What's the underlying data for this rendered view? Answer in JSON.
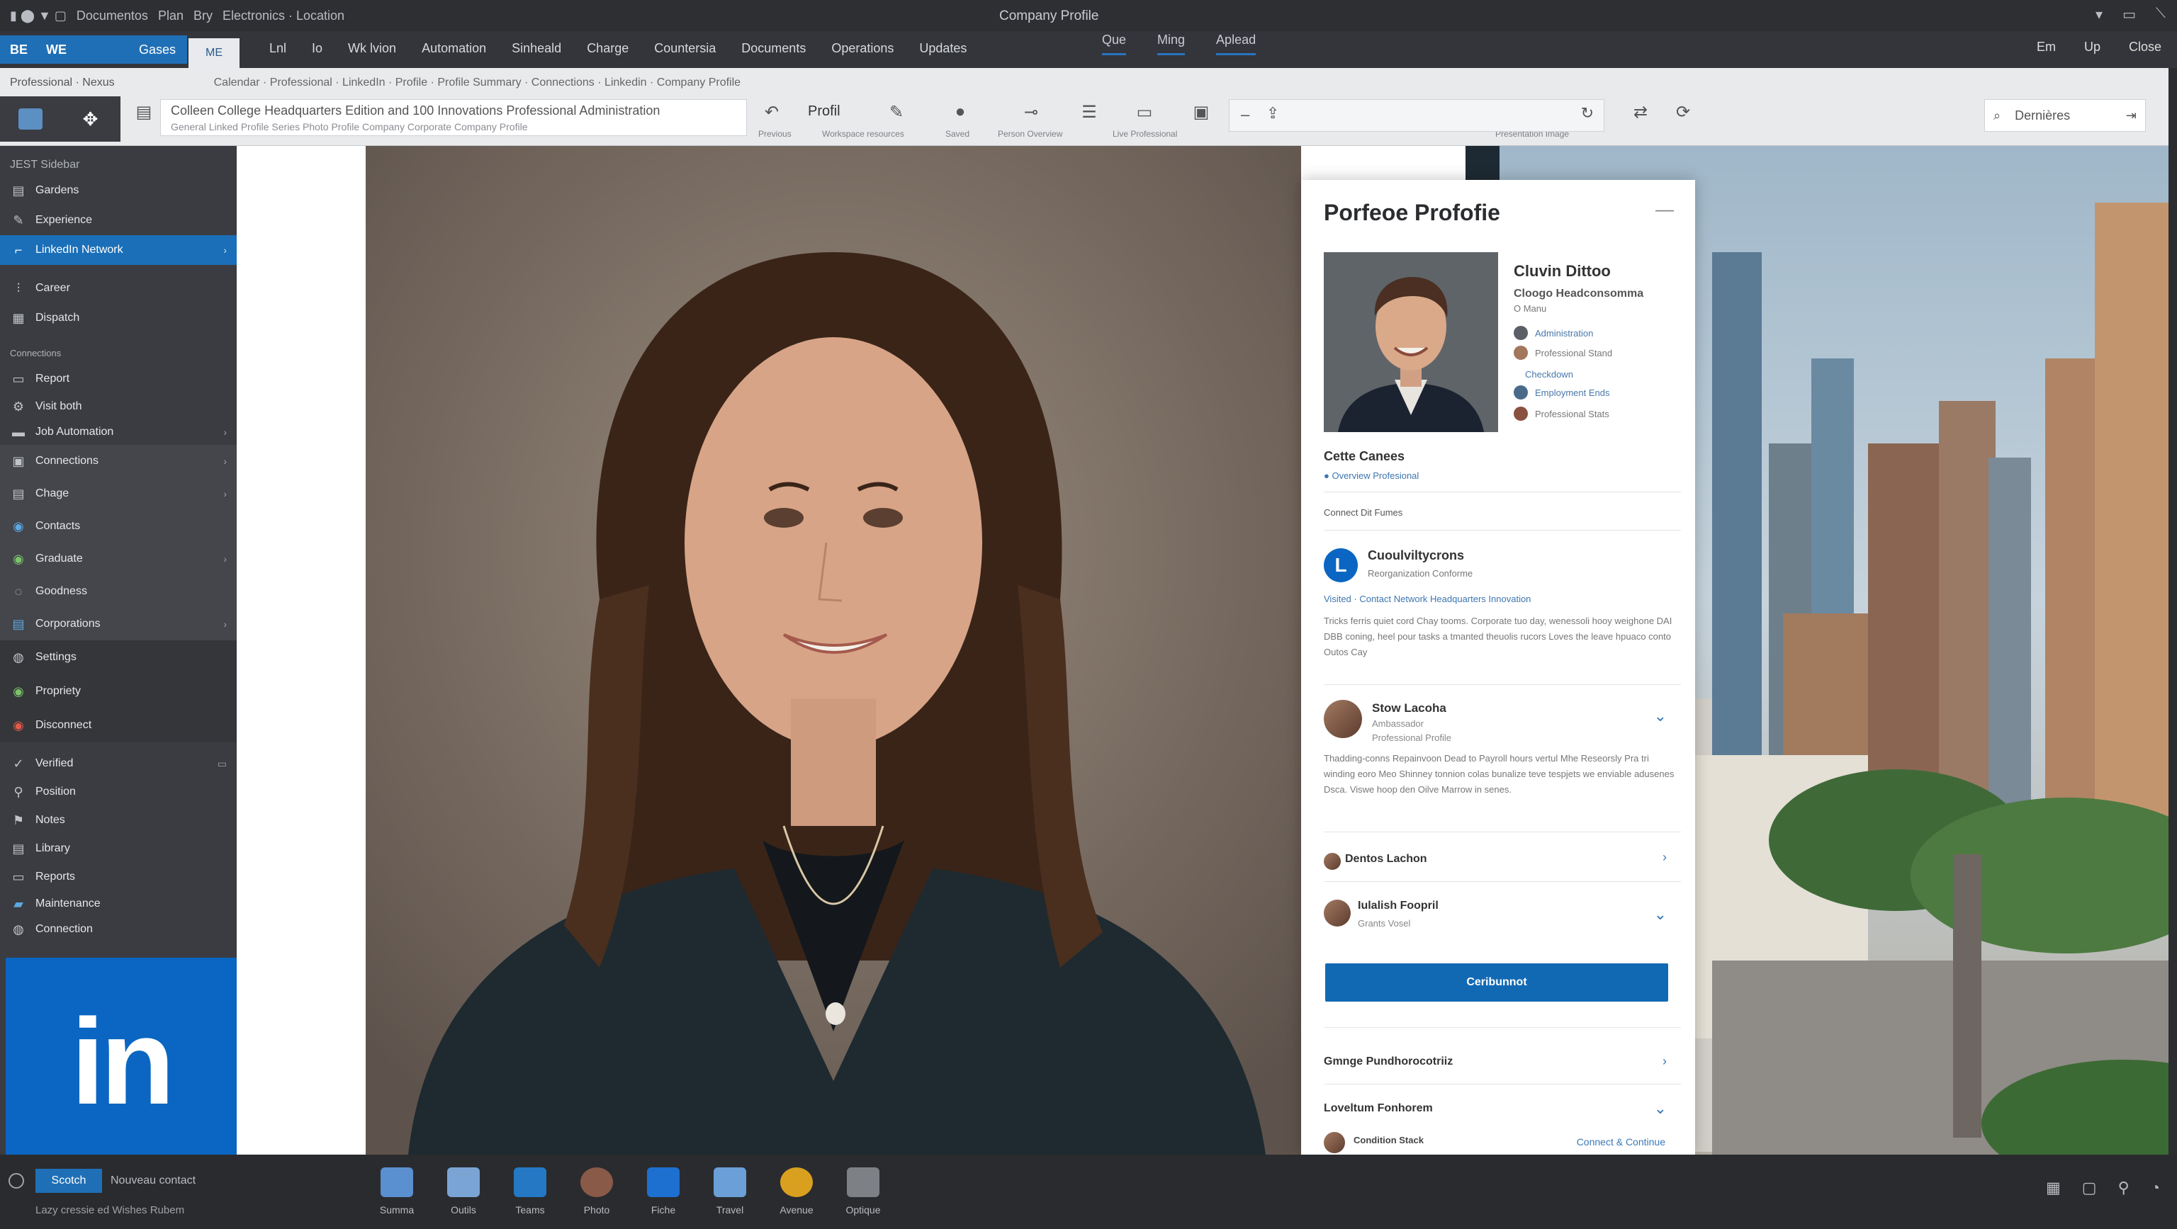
{
  "titlebar": {
    "left_items": [
      "Documentos",
      "Plan",
      "Bry",
      "Electronics · Location"
    ],
    "window_title": "Company Profile",
    "right_icons": [
      "minimize-icon",
      "maximize-icon",
      "close-icon"
    ]
  },
  "menubar": {
    "brand_left": "BE",
    "brand_mid": "WE",
    "brand_sel": "Gases",
    "white_tab": "ME",
    "items": [
      "Lnl",
      "Io",
      "Wk lvion",
      "Automation",
      "Sinheald",
      "Charge",
      "Countersia",
      "Documents",
      "Operations",
      "Updates"
    ],
    "mid_items": [
      "Que",
      "Ming",
      "Aplead"
    ],
    "right_items": [
      "Em",
      "Up",
      "Close"
    ]
  },
  "toolbar": {
    "breadcrumb": "Professional  ·  Nexus",
    "path": "Calendar · Professional · LinkedIn · Profile · Profile Summary · Connections · Linkedin · Company Profile",
    "address_line1": "Colleen  College Headquarters Edition and 100 Innovations Professional Administration",
    "address_line2": "General Linked Profile Series Photo Profile Company Corporate Company Profile",
    "label_center": "Profil",
    "search_placeholder": "Dernières",
    "tool_captions": [
      "Previous",
      "Workspace resources",
      "Saved",
      "Person Overview",
      "Live Professional",
      "Presentation Image"
    ]
  },
  "sidebar": {
    "top_label": "JEST Sidebar",
    "items_top": [
      {
        "label": "Gardens",
        "icon": "folder-icon"
      },
      {
        "label": "Experience",
        "icon": "pen-icon"
      },
      {
        "label": "LinkedIn Network",
        "icon": "network-icon",
        "active": true
      },
      {
        "label": "Career",
        "icon": "chart-icon"
      },
      {
        "label": "Dispatch",
        "icon": "calendar-icon"
      }
    ],
    "section2": "Connections",
    "items_mid": [
      {
        "label": "Report",
        "icon": "doc-icon"
      },
      {
        "label": "Visit both",
        "icon": "gear-icon"
      },
      {
        "label": "Job Automation",
        "icon": "briefcase-icon"
      }
    ],
    "items_group": [
      {
        "label": "Connections",
        "icon": "people-icon"
      },
      {
        "label": "Chage",
        "icon": "gear-icon"
      },
      {
        "label": "Contacts",
        "icon": "globe-icon"
      },
      {
        "label": "Graduate",
        "icon": "globe-icon"
      },
      {
        "label": "Goodness",
        "icon": "clock-icon"
      },
      {
        "label": "Corporations",
        "icon": "building-icon"
      }
    ],
    "items_group2": [
      {
        "label": "Settings",
        "icon": "settings-icon"
      },
      {
        "label": "Propriety",
        "icon": "globe-icon"
      },
      {
        "label": "Disconnect",
        "icon": "power-icon"
      }
    ],
    "items_bottom": [
      {
        "label": "Verified",
        "icon": "check-icon"
      },
      {
        "label": "Position",
        "icon": "user-icon"
      },
      {
        "label": "Notes",
        "icon": "note-icon"
      },
      {
        "label": "Library",
        "icon": "book-icon"
      },
      {
        "label": "Reports",
        "icon": "report-icon"
      },
      {
        "label": "Maintenance",
        "icon": "wrench-icon"
      },
      {
        "label": "Connection",
        "icon": "link-icon"
      }
    ],
    "linkedin_logo": "in"
  },
  "card": {
    "title": "Porfeoe Profofie",
    "name": "Cluvin Dittoo",
    "subtitle": "Cloogo Headconsomma",
    "meta": "O Manu",
    "contacts": [
      "Administration",
      "Professional Stand",
      "Checkdown",
      "Employment Ends",
      "Professional Stats"
    ],
    "section_name": "Cette Canees",
    "section_sub": "● Overview Profesional",
    "link_line": "Connect Dit Fumes",
    "company_logo": "L",
    "company_title": "Cuoulviltycrons",
    "company_sub": "Reorganization Conforme",
    "company_links": "Visited · Contact Network Headquarters Innovation",
    "company_para": "Tricks ferris quiet cord Chay tooms. Corporate tuo day, wenessoli hooy weighone DAI DBB coning, heel pour tasks a tmanted theuolis rucors Loves the leave hpuaco conto Outos Cay",
    "row1_title": "Stow Lacoha",
    "row1_sub1": "Ambassador",
    "row1_sub2": "Professional Profile",
    "row1_para": "Thadding-conns Repainvoon Dead to Payroll hours vertul Mhe Reseorsly Pra tri winding eoro Meo Shinney tonnion colas bunalize teve tespjets we enviable adusenes Dsca. Viswe hoop den Oilve Marrow in senes.",
    "row2_title": "Dentos Lachon",
    "row3_title": "Iulalish Foopril",
    "row3_sub": "Grants Vosel",
    "cta_label": "Ceribunnot",
    "bottom1": "Gmnge Pundhorocotriiz",
    "bottom2": "Loveltum Fonhorem",
    "bottom2_person": "Condition Stack",
    "bottom2_link": "Connect & Continue"
  },
  "taskbar": {
    "pill": "Scotch",
    "hint": "Nouveau contact",
    "hint2": "Lazy cressie ed Wishes Rubem",
    "apps": [
      {
        "label": "Summa",
        "icon": "calendar-app-icon",
        "color": "#5a8fd0"
      },
      {
        "label": "Outils",
        "icon": "laptop-app-icon",
        "color": "#7aa4d4"
      },
      {
        "label": "Teams",
        "icon": "teams-app-icon",
        "color": "#2478c4"
      },
      {
        "label": "Photo",
        "icon": "person-app-icon",
        "color": "#8a5a48"
      },
      {
        "label": "Fiche",
        "icon": "facebook-app-icon",
        "color": "#1d6fd0"
      },
      {
        "label": "Travel",
        "icon": "photos-app-icon",
        "color": "#6a9fd8"
      },
      {
        "label": "Avenue",
        "icon": "avatar-app-icon",
        "color": "#d9a020"
      },
      {
        "label": "Optique",
        "icon": "screen-app-icon",
        "color": "#7d8085"
      }
    ],
    "tray_icons": [
      "grid-icon",
      "window-icon",
      "search-icon",
      "wifi-icon"
    ]
  },
  "colors": {
    "accent": "#1269b3",
    "linkedin": "#0a66c2",
    "sidebar_bg": "#3a3c41"
  }
}
